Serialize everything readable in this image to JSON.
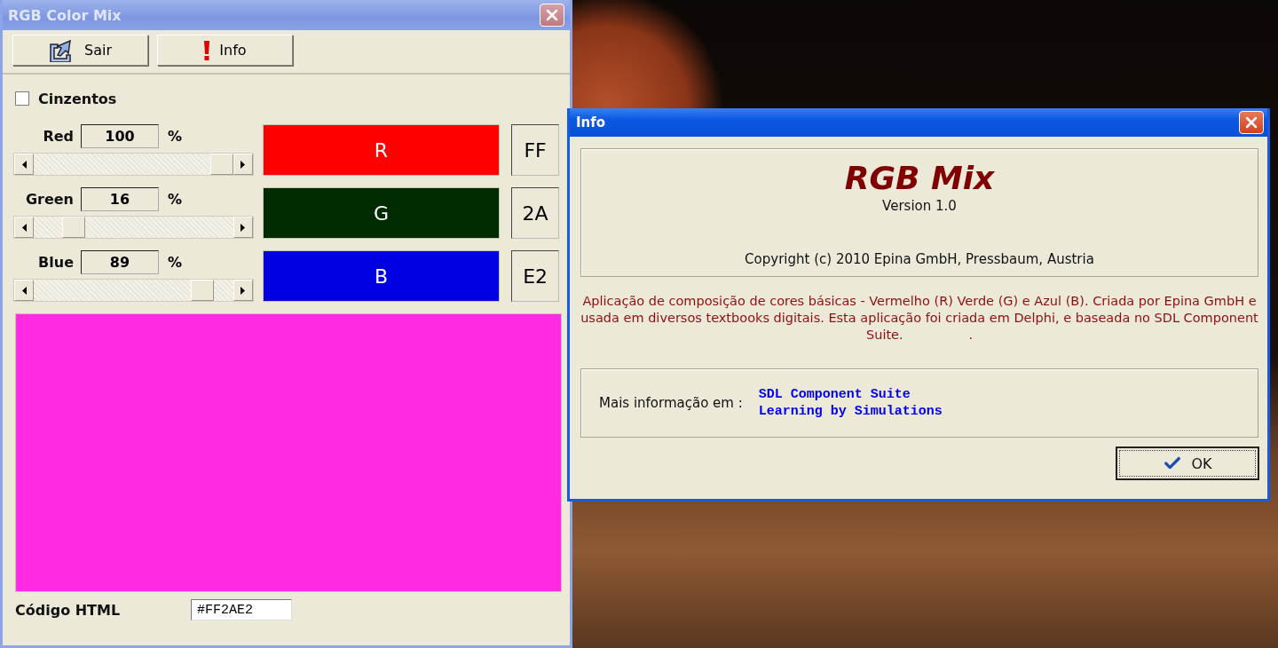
{
  "main_window": {
    "title": "RGB Color Mix",
    "toolbar": [
      {
        "kind": "exit",
        "label": "Sair"
      },
      {
        "kind": "info",
        "label": "Info"
      }
    ],
    "grayscale": {
      "label": "Cinzentos",
      "checked": false
    },
    "channels": [
      {
        "name": "Red",
        "value": "100",
        "unit": "%",
        "level": 1,
        "swatch_label": "R",
        "color": "#ff0000",
        "hex": "FF"
      },
      {
        "name": "Green",
        "value": "16",
        "unit": "%",
        "level": 0.16,
        "swatch_label": "G",
        "color": "#002a00",
        "hex": "2A"
      },
      {
        "name": "Blue",
        "value": "89",
        "unit": "%",
        "level": 0.89,
        "swatch_label": "B",
        "color": "#0000e2",
        "hex": "E2"
      }
    ],
    "preview": {
      "color": "#ff2ae2"
    },
    "html_code": {
      "label": "Código HTML",
      "value": "#FF2AE2"
    }
  },
  "info_dialog": {
    "title": "Info",
    "app_name": "RGB Mix",
    "version": "Version 1.0",
    "copyright": "Copyright (c) 2010 Epina GmbH, Pressbaum, Austria",
    "description": "Aplicação de composição de cores básicas - Vermelho (R) Verde (G) e Azul (B). Criada por Epina GmbH e  usada em diversos textbooks digitais. Esta aplicação foi criada em Delphi, e baseada no SDL Component Suite.                .",
    "more_info_label": "Mais informação em :",
    "links": [
      "SDL Component Suite",
      "Learning by Simulations"
    ],
    "ok_button": "OK"
  }
}
